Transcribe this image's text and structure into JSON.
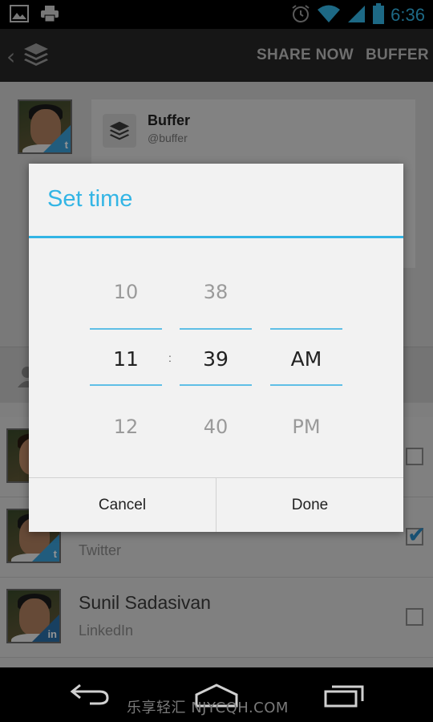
{
  "status_bar": {
    "time": "6:36",
    "icons": [
      "image-icon",
      "print-icon",
      "alarm-icon",
      "wifi-icon",
      "signal-icon",
      "battery-icon"
    ],
    "color": "#33b5e5"
  },
  "action_bar": {
    "share_now_label": "SHARE NOW",
    "buffer_label": "BUFFER"
  },
  "compose": {
    "badge_count": "1",
    "card_name": "Buffer",
    "card_handle": "@buffer"
  },
  "accounts": [
    {
      "name": "",
      "network": "",
      "checked": false
    },
    {
      "name": "",
      "network": "Twitter",
      "checked": true
    },
    {
      "name": "Sunil Sadasivan",
      "network": "LinkedIn",
      "checked": false
    }
  ],
  "dialog": {
    "title": "Set time",
    "hours": {
      "prev": "10",
      "current": "11",
      "next": "12"
    },
    "separator": ":",
    "minutes": {
      "prev": "38",
      "current": "39",
      "next": "40"
    },
    "ampm": {
      "prev": "",
      "current": "AM",
      "next": "PM"
    },
    "cancel_label": "Cancel",
    "done_label": "Done",
    "accent_color": "#33b5e5"
  },
  "watermark": "乐享轻汇  NJYCQH.COM"
}
